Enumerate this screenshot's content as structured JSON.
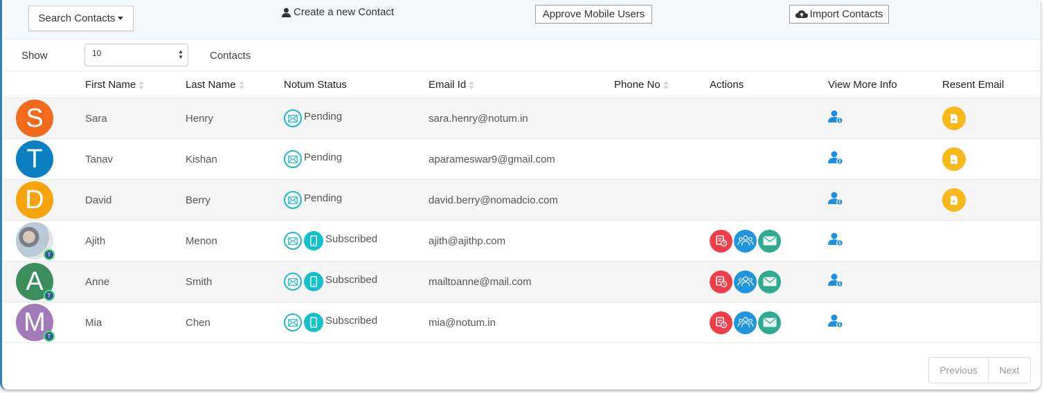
{
  "toolbar": {
    "search_label": "Search Contacts",
    "create_label": "Create a new Contact",
    "approve_label": "Approve Mobile Users",
    "import_label": "Import Contacts"
  },
  "show": {
    "label": "Show",
    "value": "10",
    "suffix": "Contacts"
  },
  "columns": {
    "first_name": "First Name",
    "last_name": "Last Name",
    "status": "Notum Status",
    "email": "Email Id",
    "phone": "Phone No",
    "actions": "Actions",
    "view_more": "View More Info",
    "resent": "Resent Email"
  },
  "rows": [
    {
      "initial": "S",
      "avatar_color": "#f26a1b",
      "first": "Sara",
      "last": "Henry",
      "status": "Pending",
      "email": "sara.henry@notum.in",
      "phone": ""
    },
    {
      "initial": "T",
      "avatar_color": "#0a7fc2",
      "first": "Tanav",
      "last": "Kishan",
      "status": "Pending",
      "email": "aparameswar9@gmail.com",
      "phone": ""
    },
    {
      "initial": "D",
      "avatar_color": "#f6a30c",
      "first": "David",
      "last": "Berry",
      "status": "Pending",
      "email": "david.berry@nomadcio.com",
      "phone": ""
    },
    {
      "initial": "",
      "avatar_color": "",
      "first": "Ajith",
      "last": "Menon",
      "status": "Subscribed",
      "email": "ajith@ajithp.com",
      "phone": ""
    },
    {
      "initial": "A",
      "avatar_color": "#3b8d5c",
      "first": "Anne",
      "last": "Smith",
      "status": "Subscribed",
      "email": "mailtoanne@mail.com",
      "phone": ""
    },
    {
      "initial": "M",
      "avatar_color": "#a07bb8",
      "first": "Mia",
      "last": "Chen",
      "status": "Subscribed",
      "email": "mia@notum.in",
      "phone": ""
    }
  ],
  "pager": {
    "previous": "Previous",
    "next": "Next"
  },
  "colors": {
    "accent": "#1f95e0",
    "resend": "#f7b81a",
    "status_icon": "#1eb7c6",
    "action_red": "#ef3e4a",
    "action_green": "#2fa98f"
  }
}
